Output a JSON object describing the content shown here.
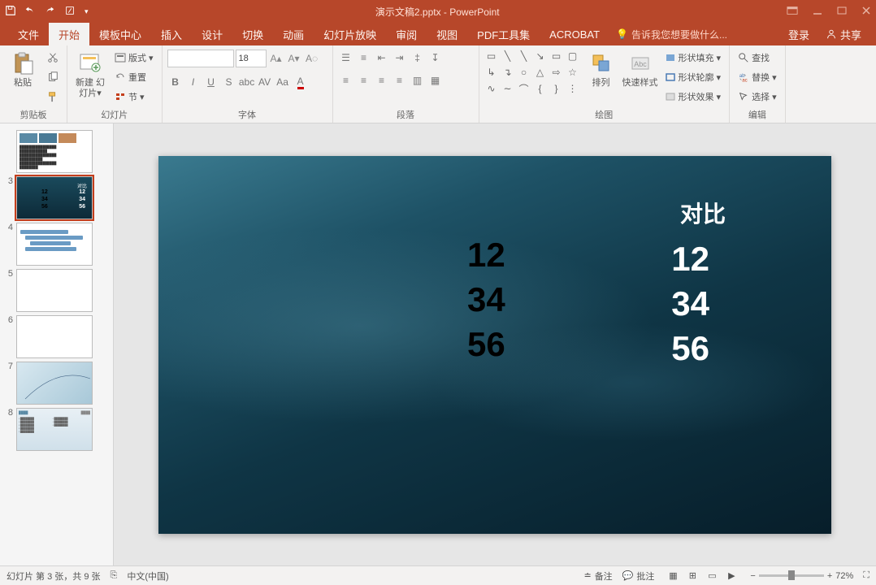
{
  "title": "演示文稿2.pptx - PowerPoint",
  "qat": {
    "save": "保存",
    "undo": "撤销",
    "redo": "重做"
  },
  "menu": {
    "file": "文件",
    "home": "开始",
    "template": "模板中心",
    "insert": "插入",
    "design": "设计",
    "transition": "切换",
    "animation": "动画",
    "slideshow": "幻灯片放映",
    "review": "审阅",
    "view": "视图",
    "pdf": "PDF工具集",
    "acrobat": "ACROBAT",
    "tellme": "告诉我您想要做什么...",
    "login": "登录",
    "share": "共享"
  },
  "ribbon": {
    "clipboard": {
      "label": "剪贴板",
      "paste": "粘贴"
    },
    "slides": {
      "label": "幻灯片",
      "new": "新建\n幻灯片",
      "layout": "版式",
      "reset": "重置",
      "section": "节"
    },
    "font": {
      "label": "字体",
      "size": "18"
    },
    "paragraph": {
      "label": "段落"
    },
    "drawing": {
      "label": "绘图",
      "arrange": "排列",
      "quickstyle": "快速样式",
      "fill": "形状填充",
      "outline": "形状轮廓",
      "effects": "形状效果"
    },
    "editing": {
      "label": "编辑",
      "find": "查找",
      "replace": "替换",
      "select": "选择"
    }
  },
  "slide": {
    "title": "对比",
    "col1": [
      "12",
      "34",
      "56"
    ],
    "col2": [
      "12",
      "34",
      "56"
    ]
  },
  "thumbs": {
    "count": 9,
    "selected": 3
  },
  "status": {
    "slideinfo": "幻灯片 第 3 张，共 9 张",
    "lang": "中文(中国)",
    "notes": "备注",
    "comments": "批注",
    "zoom": "72%"
  }
}
